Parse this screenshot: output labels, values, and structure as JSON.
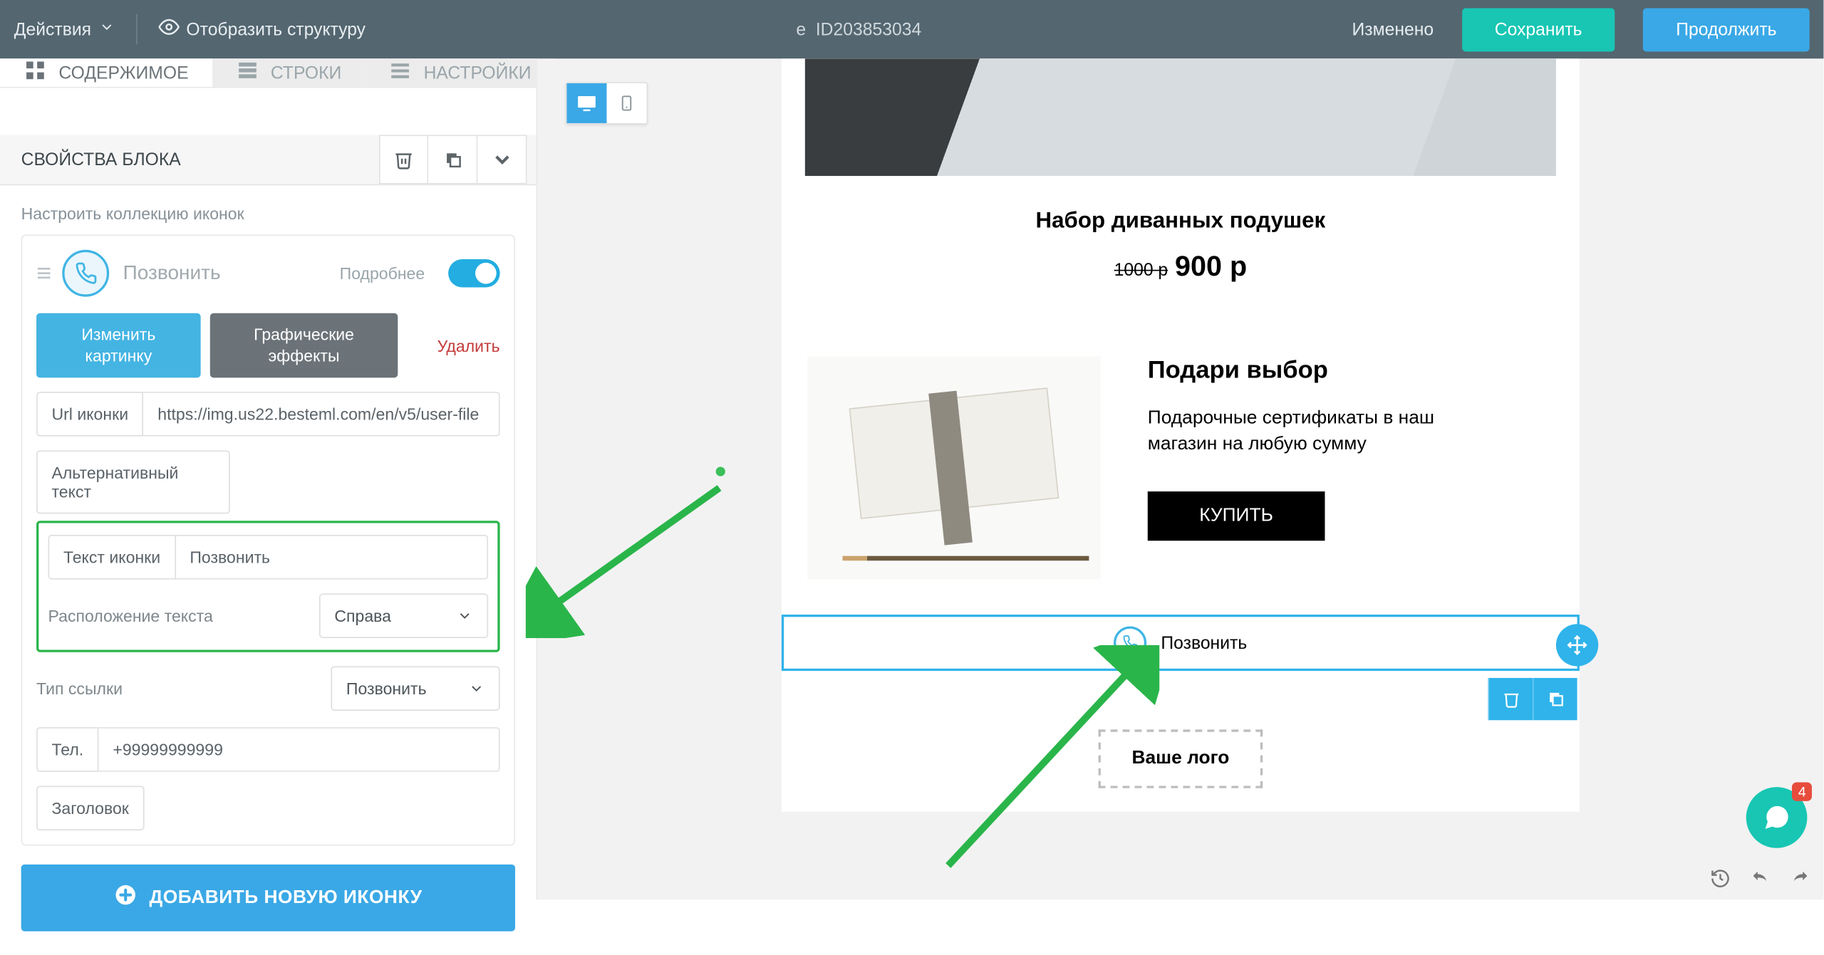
{
  "topbar": {
    "actions": "Действия",
    "show_structure": "Отобразить структуру",
    "id_prefix": "e",
    "id": "ID203853034",
    "changed": "Изменено",
    "save": "Сохранить",
    "continue": "Продолжить"
  },
  "tabs": {
    "content": "СОДЕРЖИМОЕ",
    "rows": "СТРОКИ",
    "settings": "НАСТРОЙКИ"
  },
  "panel": {
    "title": "СВОЙСТВА БЛОКА",
    "hint": "Настроить коллекцию иконок",
    "icon_label": "Позвонить",
    "more": "Подробнее",
    "change_image": "Изменить картинку",
    "graphic_fx": "Графические эффекты",
    "delete": "Удалить",
    "url_label": "Url иконки",
    "url_value": "https://img.us22.besteml.com/en/v5/user-file",
    "alt_label": "Альтернативный текст",
    "icon_text_label": "Текст иконки",
    "icon_text_value": "Позвонить",
    "text_position_label": "Расположение текста",
    "text_position_value": "Справа",
    "link_type_label": "Тип ссылки",
    "link_type_value": "Позвонить",
    "tel_label": "Тел.",
    "tel_value": "+99999999999",
    "header_label": "Заголовок",
    "add_icon": "ДОБАВИТЬ НОВУЮ ИКОНКУ"
  },
  "email": {
    "product_title": "Набор диванных подушек",
    "old_price": "1000 р",
    "price": "900 р",
    "gift_title": "Подари выбор",
    "gift_text": "Подарочные сертификаты в наш магазин на любую сумму",
    "buy": "КУПИТЬ",
    "callbar": "Позвонить",
    "logo": "Ваше лого"
  },
  "chat_badge": "4"
}
